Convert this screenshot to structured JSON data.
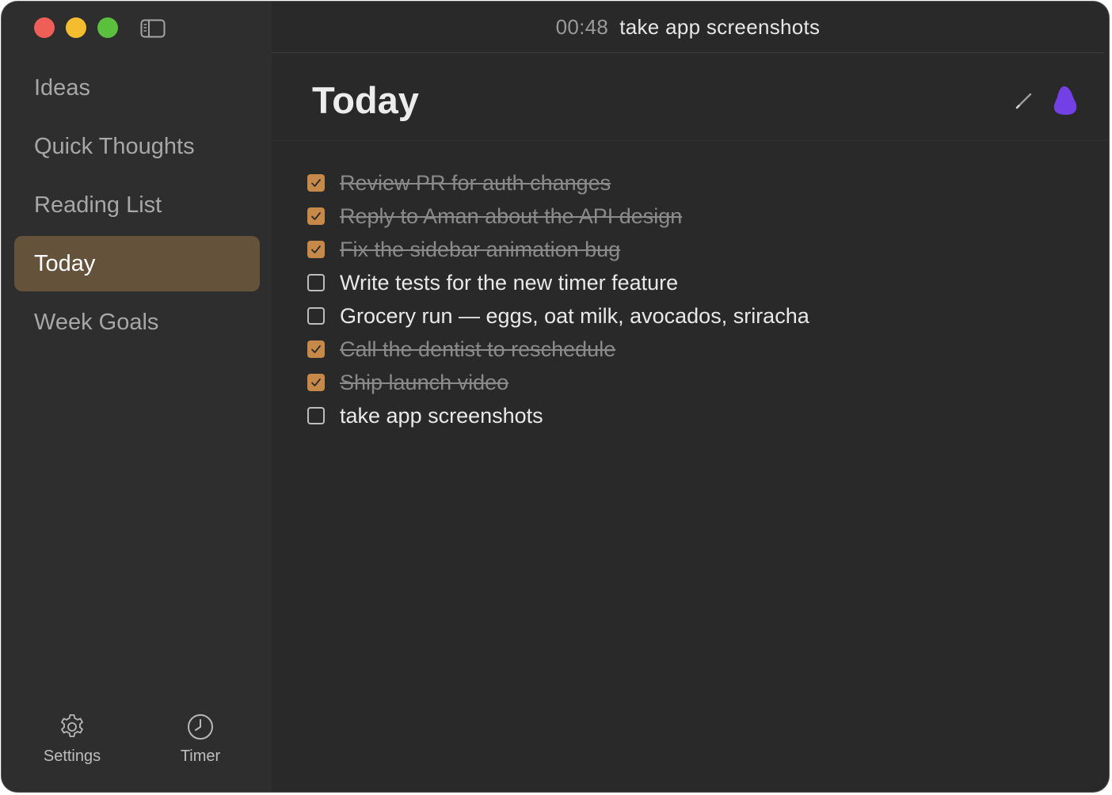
{
  "sidebar": {
    "items": [
      {
        "label": "Ideas"
      },
      {
        "label": "Quick Thoughts"
      },
      {
        "label": "Reading List"
      },
      {
        "label": "Today",
        "active": true
      },
      {
        "label": "Week Goals"
      }
    ],
    "footer": {
      "settings_label": "Settings",
      "settings_icon": "gear-icon",
      "timer_label": "Timer",
      "timer_icon": "clock-icon"
    }
  },
  "titlebar": {
    "timer_time": "00:48",
    "timer_task": "take app screenshots"
  },
  "header": {
    "title": "Today",
    "edit_icon": "pencil-icon",
    "blob_icon": "blob-icon",
    "blob_color": "#7340e6"
  },
  "tasks": [
    {
      "text": "Review PR for auth changes",
      "done": true
    },
    {
      "text": "Reply to Aman about the API design",
      "done": true
    },
    {
      "text": "Fix the sidebar animation bug",
      "done": true
    },
    {
      "text": "Write tests for the new timer feature",
      "done": false
    },
    {
      "text": "Grocery run — eggs, oat milk, avocados, sriracha",
      "done": false
    },
    {
      "text": "Call the dentist to reschedule",
      "done": true
    },
    {
      "text": "Ship launch video",
      "done": true
    },
    {
      "text": "take app screenshots",
      "done": false
    }
  ],
  "colors": {
    "accent": "#c7894a",
    "active_nav": "#65523a",
    "window_bg": "#292929",
    "sidebar_bg": "#2e2e2e"
  }
}
